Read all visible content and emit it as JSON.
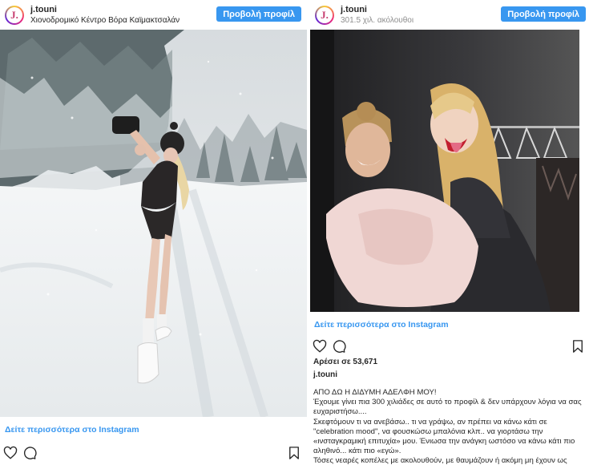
{
  "left_post": {
    "avatar_letter": "J.",
    "username": "j.touni",
    "location": "Χιονοδρομικό Κέντρο Βόρα Καϊμακτσαλάν",
    "profile_button": "Προβολή προφίλ",
    "more_link": "Δείτε περισσότερα στο Instagram",
    "icons": [
      "heart-icon",
      "comment-icon",
      "bookmark-icon"
    ]
  },
  "right_post": {
    "avatar_letter": "J.",
    "username": "j.touni",
    "followers": "301.5 χιλ. ακόλουθοι",
    "profile_button": "Προβολή προφίλ",
    "more_link": "Δείτε περισσότερα στο Instagram",
    "likes": "Αρέσει σε 53,671",
    "caption_username": "j.touni",
    "caption_lines": [
      "ΑΠΟ ΔΩ Η ΔΙΔΥΜΗ ΑΔΕΛΦΗ ΜΟΥ!",
      "Έχουμε γίνει πια 300 χιλιάδες σε αυτό το προφίλ & δεν υπάρχουν λόγια να σας ευχαριστήσω....",
      "Σκεφτόμουν τι να ανεβάσω.. τι να γράψω, αν πρέπει να κάνω κάτι σε \"celebration mood\", να φουσκώσω μπαλόνια κλπ.. να γιορτάσω την «ινσταγκραμική επιτυχία» μου. Ένιωσα την ανάγκη ωστόσο να κάνω κάτι πιο αληθινό... κάτι πιο «εγώ».",
      "Τόσες νεαρές κοπέλες με ακολουθούν, με θαυμάζουν ή ακόμη μη έχουν ως πρότυπο..."
    ],
    "icons": [
      "heart-icon",
      "comment-icon",
      "bookmark-icon"
    ]
  },
  "colors": {
    "link_blue": "#3897f0",
    "button_blue": "#3897f0",
    "text": "#262626",
    "muted": "#8e8e8e"
  }
}
